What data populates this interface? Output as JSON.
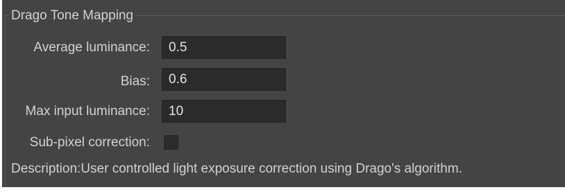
{
  "group": {
    "title": "Drago Tone Mapping"
  },
  "fields": {
    "average_luminance": {
      "label": "Average luminance:",
      "value": "0.5"
    },
    "bias": {
      "label": "Bias:",
      "value": "0.6"
    },
    "max_input_luminance": {
      "label": "Max input luminance:",
      "value": "10"
    },
    "sub_pixel_correction": {
      "label": "Sub-pixel correction:",
      "checked": false
    }
  },
  "description": "Description:User controlled light exposure correction using Drago's algorithm.",
  "colors": {
    "panel_background": "#444444",
    "field_background": "#2b2b2b",
    "label_text": "#d2d2d2",
    "field_text": "#e4e4e4"
  }
}
